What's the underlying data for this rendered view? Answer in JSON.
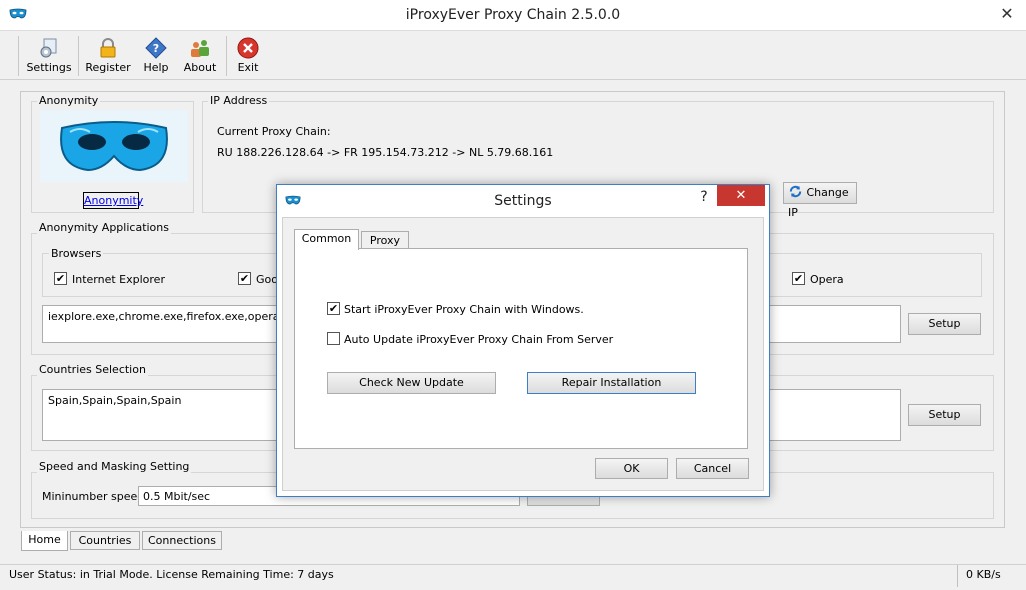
{
  "window": {
    "title": "iProxyEver Proxy Chain 2.5.0.0",
    "close": "✕"
  },
  "toolbar": {
    "settings": "Settings",
    "register": "Register",
    "help": "Help",
    "about": "About",
    "exit": "Exit"
  },
  "anonymity": {
    "group": "Anonymity",
    "link": "Anonymity"
  },
  "ip": {
    "group": "IP Address",
    "current_label": "Current Proxy Chain:",
    "chain": "RU 188.226.128.64 -> FR 195.154.73.212 -> NL 5.79.68.161",
    "change_ip": "Change IP"
  },
  "apps": {
    "group": "Anonymity Applications",
    "browsers_group": "Browsers",
    "ie": "Internet Explorer",
    "goo": "Goo",
    "opera": "Opera",
    "exes": "iexplore.exe,chrome.exe,firefox.exe,opera.exe",
    "setup": "Setup"
  },
  "countries": {
    "group": "Countries Selection",
    "value": "Spain,Spain,Spain,Spain",
    "setup": "Setup"
  },
  "speed": {
    "group": "Speed and Masking Setting",
    "label": "Mininumber speed:",
    "value": "0.5 Mbit/sec"
  },
  "bottom_tabs": [
    "Home",
    "Countries",
    "Connections"
  ],
  "status": {
    "left": "User Status:  in Trial Mode. License Remaining Time: 7 days",
    "right": "0 KB/s"
  },
  "dialog": {
    "title": "Settings",
    "help": "?",
    "close": "✕",
    "tabs": [
      "Common",
      "Proxy"
    ],
    "opt_start": "Start iProxyEver Proxy Chain with Windows.",
    "opt_start_checked": true,
    "opt_update": "Auto Update iProxyEver Proxy Chain From Server",
    "opt_update_checked": false,
    "check_update": "Check New Update",
    "repair": "Repair Installation",
    "ok": "OK",
    "cancel": "Cancel"
  },
  "colors": {
    "accent": "#3c7fc4",
    "close_red": "#c7372f",
    "mask_blue": "#1aa6e6"
  }
}
